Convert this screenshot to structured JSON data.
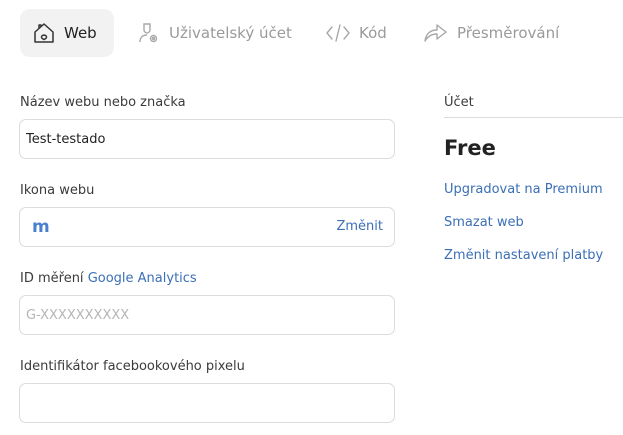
{
  "tabs": [
    {
      "label": "Web",
      "icon": "home-icon",
      "active": true
    },
    {
      "label": "Uživatelský účet",
      "icon": "user-settings-icon",
      "active": false
    },
    {
      "label": "Kód",
      "icon": "code-icon",
      "active": false
    },
    {
      "label": "Přesměrování",
      "icon": "redirect-icon",
      "active": false
    }
  ],
  "form": {
    "site_name": {
      "label": "Název webu nebo značka",
      "value": "Test-testado"
    },
    "site_icon": {
      "label": "Ikona webu",
      "icon_letter": "m",
      "change_label": "Změnit"
    },
    "analytics": {
      "label_prefix": "ID měření",
      "label_link": "Google Analytics",
      "placeholder": "G-XXXXXXXXXX",
      "value": ""
    },
    "facebook_pixel": {
      "label": "Identifikátor facebookového pixelu",
      "value": ""
    }
  },
  "account": {
    "title": "Účet",
    "plan": "Free",
    "links": {
      "upgrade": "Upgradovat na Premium",
      "delete": "Smazat web",
      "billing": "Změnit nastavení platby"
    }
  },
  "colors": {
    "link": "#3b6fb6",
    "active_tab_bg": "#f2f2f2",
    "inactive_text": "#9a9a9a"
  }
}
